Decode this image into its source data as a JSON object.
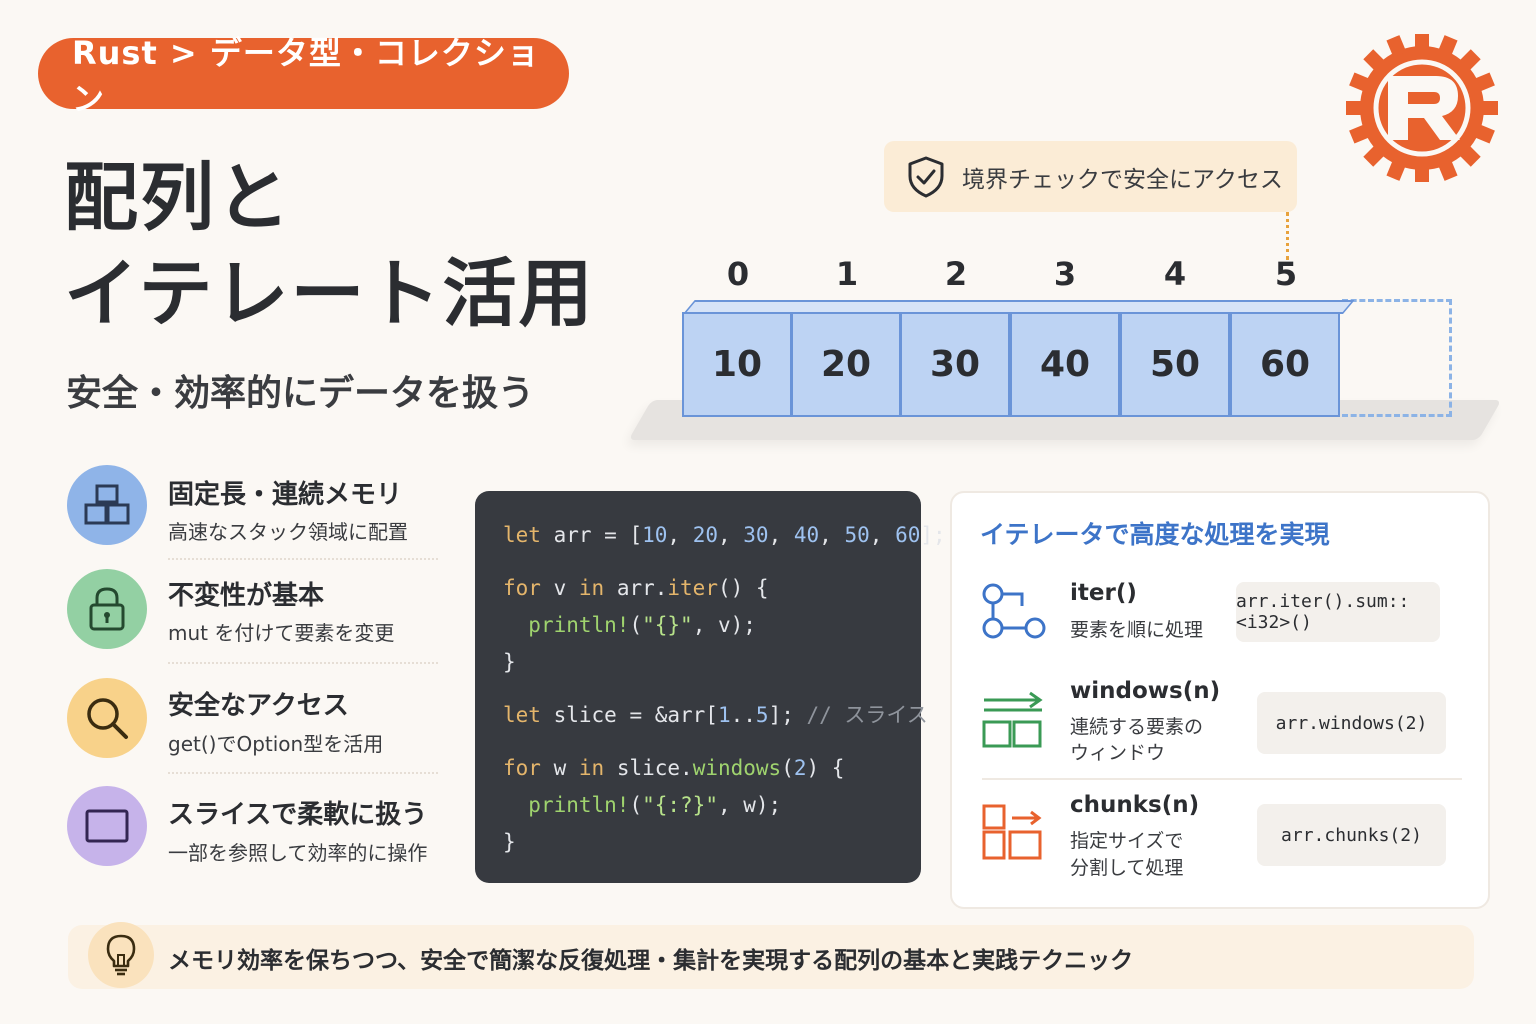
{
  "breadcrumb": "Rust > データ型・コレクション",
  "title": {
    "line1": "配列と",
    "line2": "イテレート活用"
  },
  "subtitle": "安全・効率的にデータを扱う",
  "callout": {
    "text": "境界チェックで安全にアクセス",
    "icon": "shield-check-icon"
  },
  "array": {
    "indices": [
      "0",
      "1",
      "2",
      "3",
      "4",
      "5"
    ],
    "values": [
      "10",
      "20",
      "30",
      "40",
      "50",
      "60"
    ]
  },
  "features": [
    {
      "title": "固定長・連続メモリ",
      "desc": "高速なスタック領域に配置",
      "icon": "blocks-icon",
      "color": "#8fb4e8"
    },
    {
      "title": "不変性が基本",
      "desc": "mut を付けて要素を変更",
      "icon": "lock-icon",
      "color": "#93d0a3"
    },
    {
      "title": "安全なアクセス",
      "desc": "get()でOption型を活用",
      "icon": "search-icon",
      "color": "#f8d28a"
    },
    {
      "title": "スライスで柔軟に扱う",
      "desc": "一部を参照して効率的に操作",
      "icon": "slice-icon",
      "color": "#c6b3ea"
    }
  ],
  "code": {
    "l1_kw": "let",
    "l1_a": " arr = [",
    "l1_n1": "10",
    "l1_n2": "20",
    "l1_n3": "30",
    "l1_n4": "40",
    "l1_n5": "50",
    "l1_n6": "60",
    "l1_end": "];",
    "l2_kw": "for",
    "l2_a": " v ",
    "l2_in": "in",
    "l2_b": " arr.",
    "l2_fn": "iter",
    "l2_c": "() {",
    "l3_fn": "println!",
    "l3_a": "(",
    "l3_str": "\"{}\"",
    "l3_b": ", v);",
    "l4": "}",
    "l5_kw": "let",
    "l5_a": " slice = &arr[",
    "l5_n1": "1",
    "l5_dots": "..",
    "l5_n2": "5",
    "l5_b": "]; ",
    "l5_cmt": "// スライス",
    "l6_kw": "for",
    "l6_a": " w ",
    "l6_in": "in",
    "l6_b": " slice.",
    "l6_fn": "windows",
    "l6_c": "(",
    "l6_n": "2",
    "l6_d": ") {",
    "l7_fn": "println!",
    "l7_a": "(",
    "l7_str": "\"{:?}\"",
    "l7_b": ", w);",
    "l8": "}"
  },
  "iterators": {
    "heading": "イテレータで高度な処理を実現",
    "items": [
      {
        "name": "iter()",
        "desc1": "要素を順に処理",
        "desc2": "",
        "example": "arr.iter().sum::<i32>()",
        "icon": "flow-nodes-icon"
      },
      {
        "name": "windows(n)",
        "desc1": "連続する要素の",
        "desc2": "ウィンドウ",
        "example": "arr.windows(2)",
        "icon": "window-boxes-icon"
      },
      {
        "name": "chunks(n)",
        "desc1": "指定サイズで",
        "desc2": "分割して処理",
        "example": "arr.chunks(2)",
        "icon": "chunk-boxes-icon"
      }
    ]
  },
  "footer": {
    "text": "メモリ効率を保ちつつ、安全で簡潔な反復処理・集計を実現する配列の基本と実践テクニック",
    "icon": "lightbulb-icon"
  },
  "colors": {
    "accent": "#e8622e",
    "array_cell": "#bdd3f3",
    "code_bg": "#373a40",
    "iter_heading": "#3d74c8"
  }
}
